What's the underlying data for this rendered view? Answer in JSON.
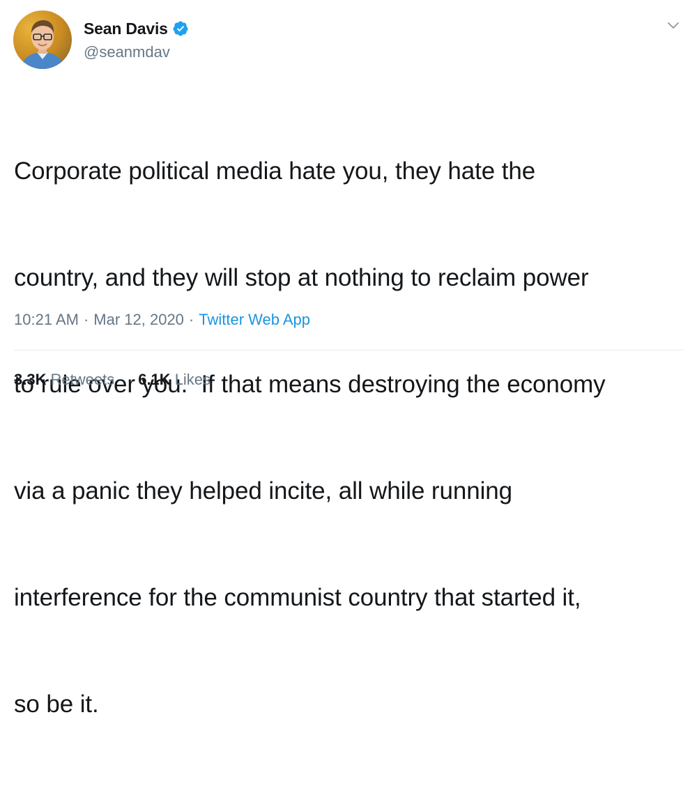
{
  "tweet": {
    "author": {
      "display_name": "Sean Davis",
      "handle": "@seanmdav",
      "verified": true,
      "avatar_icon": "profile-photo"
    },
    "text_lines": [
      "Corporate political media hate you, they hate the",
      "country, and they will stop at nothing to reclaim power",
      "to rule over you.  If that means destroying the economy",
      "via a panic they helped incite, all while running",
      "interference for the communist country that started it,",
      "so be it."
    ],
    "meta": {
      "time": "10:21 AM",
      "separator": "·",
      "date": "Mar 12, 2020",
      "source": "Twitter Web App"
    },
    "stats": {
      "retweets_count": "3.3K",
      "retweets_label": "Retweets",
      "likes_count": "6.1K",
      "likes_label": "Likes"
    }
  },
  "colors": {
    "text_primary": "#14171a",
    "text_secondary": "#657786",
    "link": "#1b95e0",
    "verified": "#1da1f2",
    "divider": "#e6ecf0"
  },
  "icons": {
    "verified": "verified-badge-icon",
    "menu": "chevron-down-icon"
  }
}
